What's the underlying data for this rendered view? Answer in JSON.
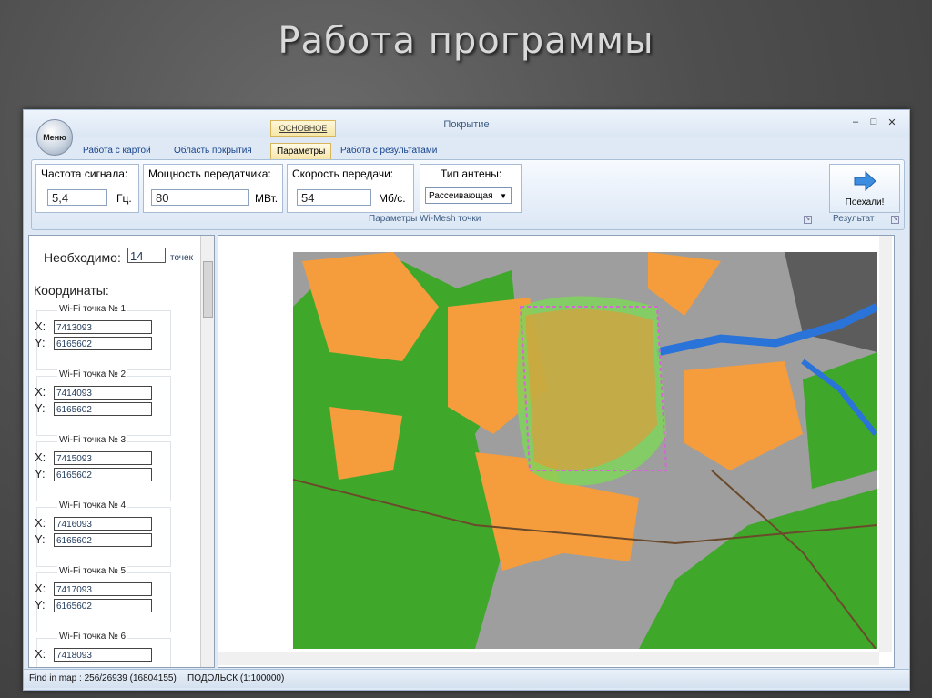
{
  "slide_title": "Работа программы",
  "window": {
    "title": "Покрытие",
    "controls": {
      "minimize": "–",
      "maximize": "□",
      "close": "✕"
    }
  },
  "menu_orb": "Меню",
  "context_tab": "ОСНОВНОЕ",
  "tabs": [
    {
      "label": "Работа с картой"
    },
    {
      "label": "Область покрытия"
    },
    {
      "label": "Параметры",
      "active": true
    },
    {
      "label": "Работа с результатами"
    }
  ],
  "ribbon": {
    "frequency": {
      "label": "Частота сигнала:",
      "value": "5,4",
      "unit": "Гц."
    },
    "power": {
      "label": "Мощность передатчика:",
      "value": "80",
      "unit": "МВт."
    },
    "speed": {
      "label": "Скорость передачи:",
      "value": "54",
      "unit": "Мб/с."
    },
    "antenna": {
      "label": "Тип антены:",
      "value": "Рассеивающая"
    },
    "group_caption": "Параметры Wi-Mesh точки",
    "go_button": "Поехали!",
    "result_caption": "Результат"
  },
  "left": {
    "need_label": "Необходимо:",
    "need_value": "14",
    "need_unit": "точек",
    "coords_label": "Координаты:",
    "x_label": "X:",
    "y_label": "Y:",
    "points": [
      {
        "title": "Wi-Fi точка № 1",
        "x": "7413093",
        "y": "6165602"
      },
      {
        "title": "Wi-Fi точка № 2",
        "x": "7414093",
        "y": "6165602"
      },
      {
        "title": "Wi-Fi точка № 3",
        "x": "7415093",
        "y": "6165602"
      },
      {
        "title": "Wi-Fi точка № 4",
        "x": "7416093",
        "y": "6165602"
      },
      {
        "title": "Wi-Fi точка № 5",
        "x": "7417093",
        "y": "6165602"
      },
      {
        "title": "Wi-Fi точка № 6",
        "x": "7418093"
      }
    ]
  },
  "status": {
    "find": "Find in map : 256/26939 (16804155)",
    "map_name": "ПОДОЛЬСК (1:100000)"
  },
  "colors": {
    "map_background": "#9e9e9e",
    "urban": "#f59c3c",
    "forest": "#3fa82b",
    "water": "#2a73d9",
    "coverage": "#7fd35a"
  }
}
